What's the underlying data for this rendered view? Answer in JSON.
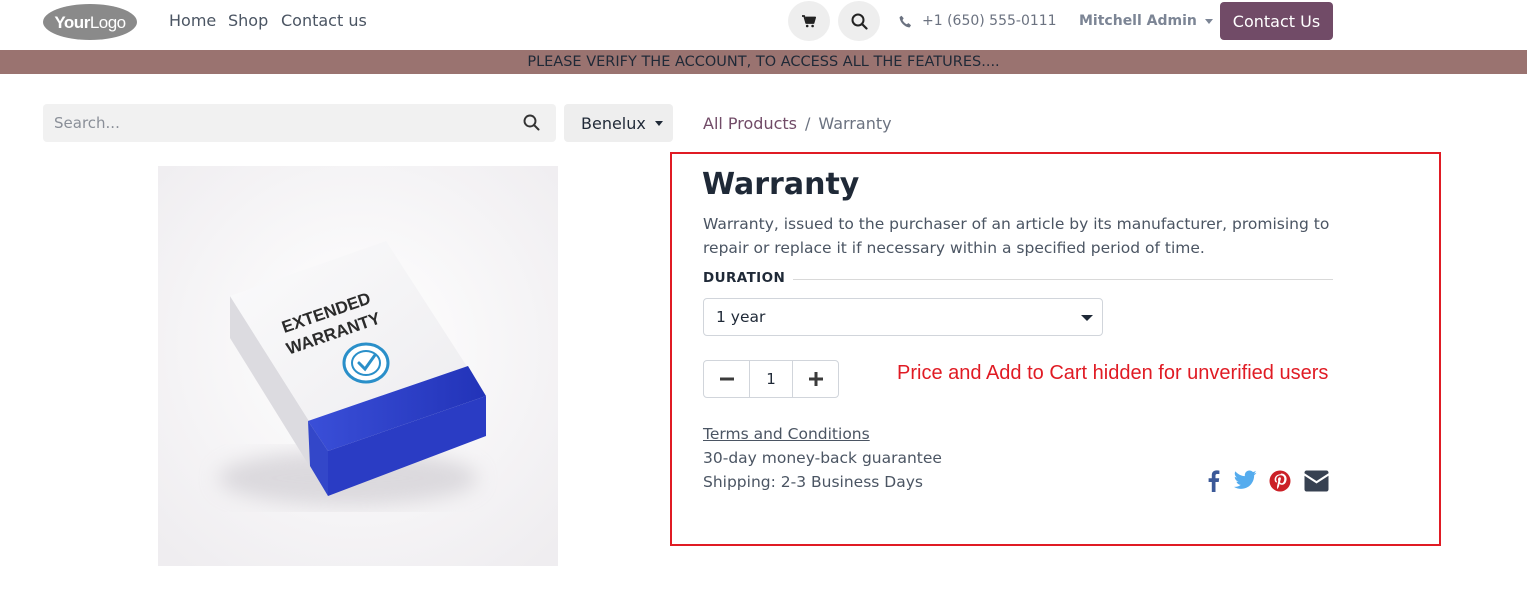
{
  "header": {
    "logo_text": "YourLogo",
    "nav": [
      "Home",
      "Shop",
      "Contact us"
    ],
    "phone": "+1 (650) 555-0111",
    "user": "Mitchell Admin",
    "contact_button": "Contact Us"
  },
  "banner": "PLEASE VERIFY THE ACCOUNT, TO ACCESS ALL THE FEATURES....",
  "search": {
    "placeholder": "Search..."
  },
  "pricelist": "Benelux",
  "breadcrumb": {
    "parent": "All Products",
    "separator": "/",
    "current": "Warranty"
  },
  "product": {
    "image_text": [
      "EXTENDED",
      "WARRANTY"
    ],
    "title": "Warranty",
    "description": "Warranty, issued to the purchaser of an article by its manufacturer, promising to repair or replace it if necessary within a specified period of time.",
    "attribute_label": "DURATION",
    "attribute_value": "1 year",
    "quantity": "1",
    "hidden_note": "Price and Add to Cart hidden for unverified users",
    "terms": "Terms and Conditions",
    "guarantee": "30-day money-back guarantee",
    "shipping": "Shipping: 2-3 Business Days"
  },
  "share_icons": [
    "facebook-icon",
    "twitter-icon",
    "pinterest-icon",
    "envelope-icon"
  ],
  "colors": {
    "brand": "#714b67",
    "banner": "#9a7370",
    "highlight": "#e01b24"
  }
}
